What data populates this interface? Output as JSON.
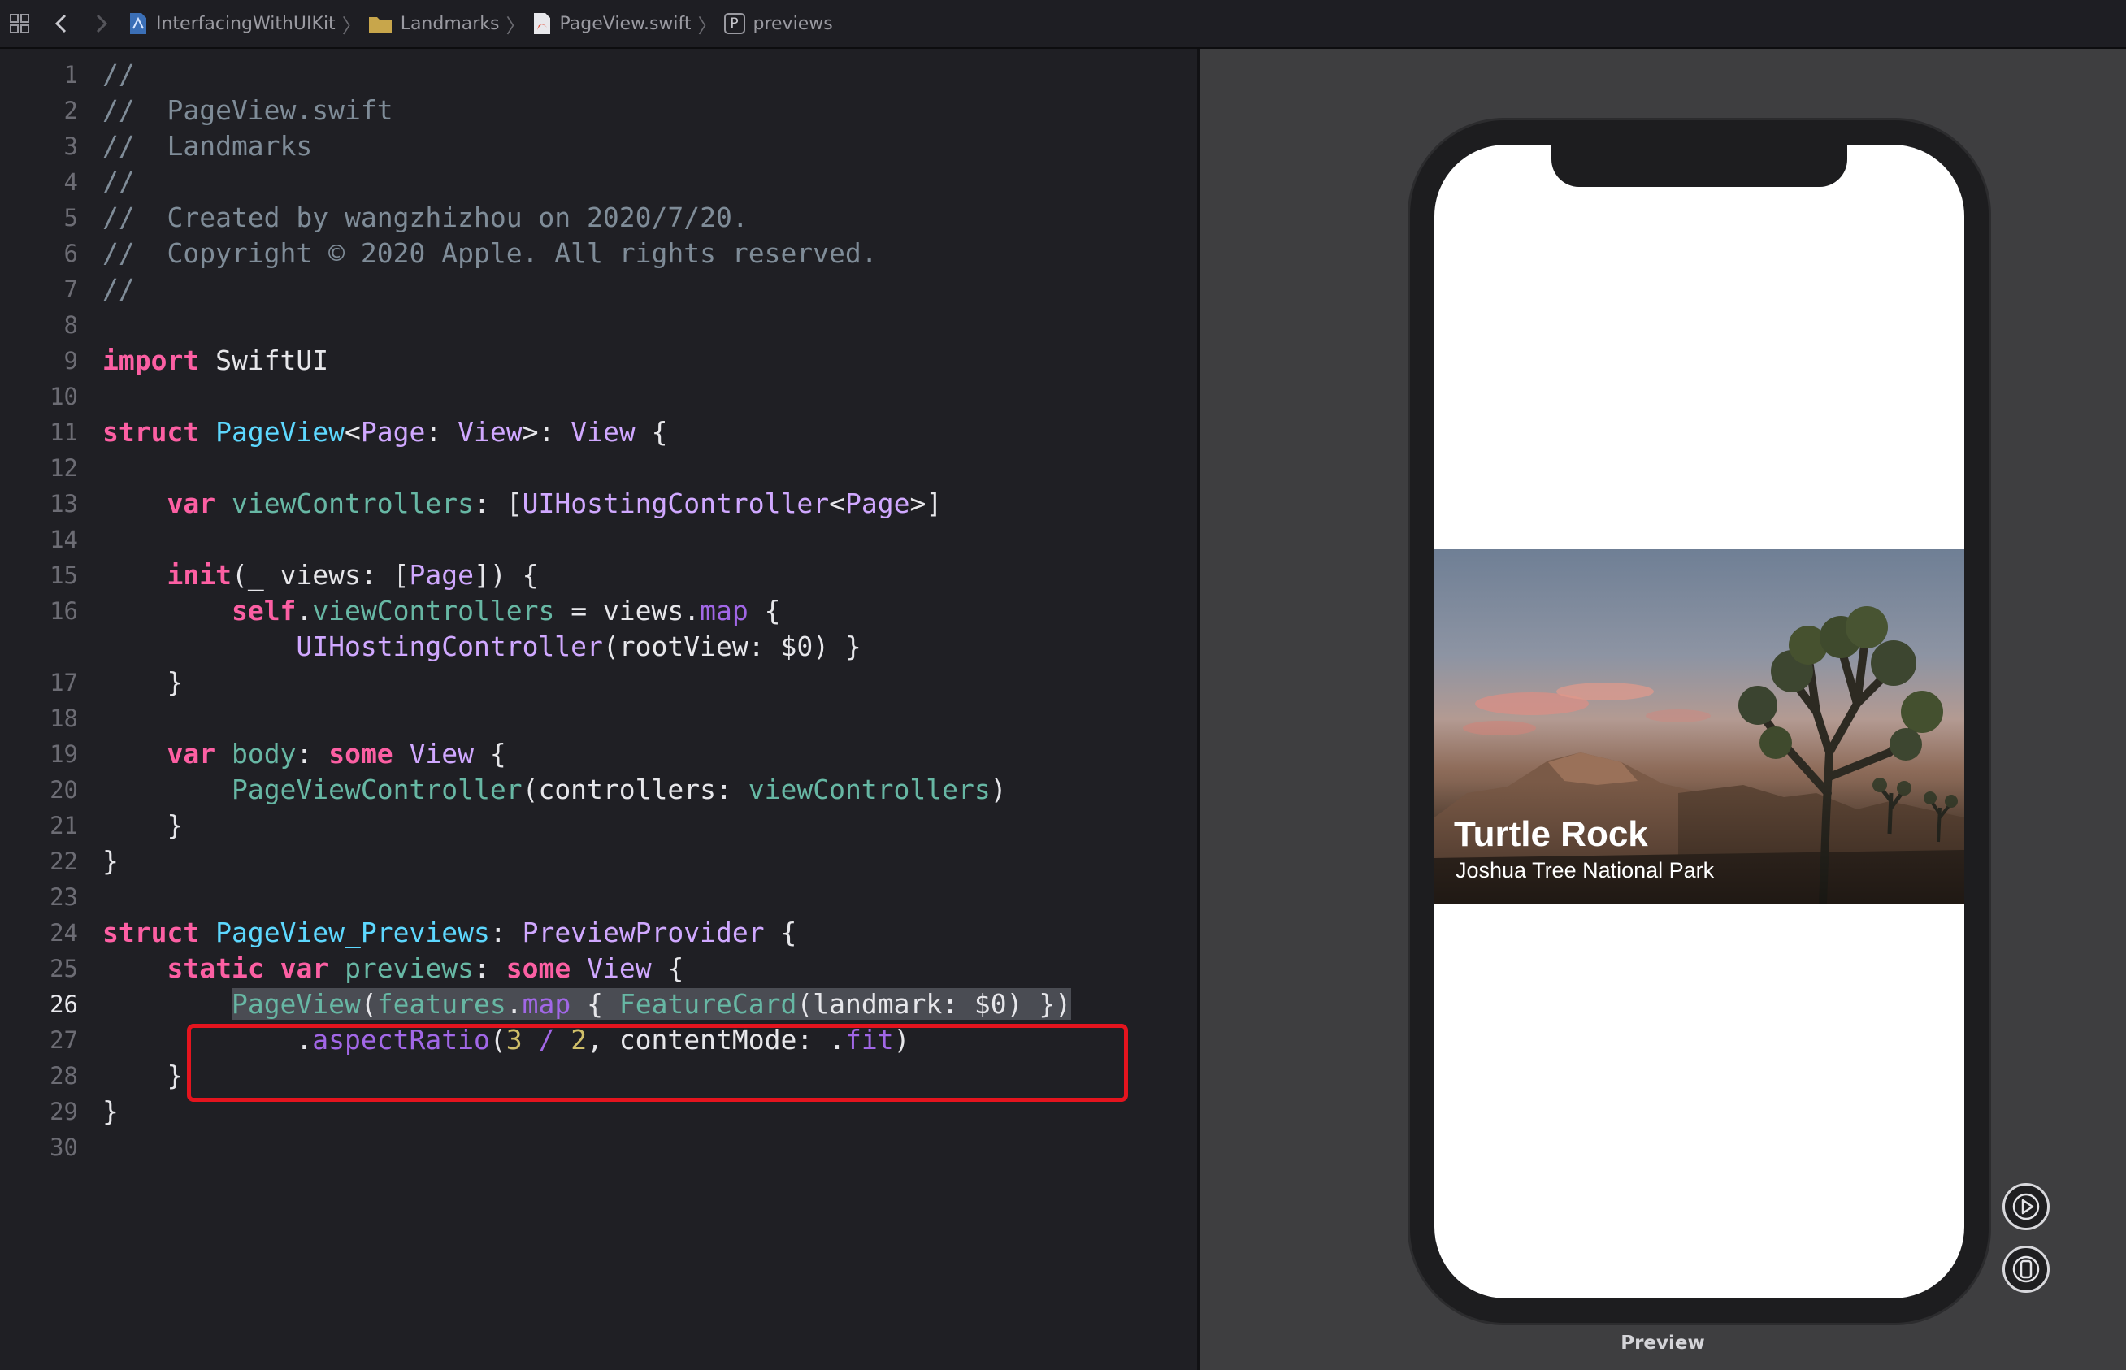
{
  "breadcrumb": {
    "items": [
      {
        "label": "InterfacingWithUIKit",
        "icon": "project-icon"
      },
      {
        "label": "Landmarks",
        "icon": "folder-icon"
      },
      {
        "label": "PageView.swift",
        "icon": "swift-file-icon"
      },
      {
        "label": "previews",
        "icon": "property-icon",
        "badge": "P"
      }
    ]
  },
  "editor": {
    "current_line": 26,
    "lines": [
      {
        "n": "1",
        "tokens": [
          [
            "cmt",
            "//"
          ]
        ]
      },
      {
        "n": "2",
        "tokens": [
          [
            "cmt",
            "//  PageView.swift"
          ]
        ]
      },
      {
        "n": "3",
        "tokens": [
          [
            "cmt",
            "//  Landmarks"
          ]
        ]
      },
      {
        "n": "4",
        "tokens": [
          [
            "cmt",
            "//"
          ]
        ]
      },
      {
        "n": "5",
        "tokens": [
          [
            "cmt",
            "//  Created by wangzhizhou on 2020/7/20."
          ]
        ]
      },
      {
        "n": "6",
        "tokens": [
          [
            "cmt",
            "//  Copyright © 2020 Apple. All rights reserved."
          ]
        ]
      },
      {
        "n": "7",
        "tokens": [
          [
            "cmt",
            "//"
          ]
        ]
      },
      {
        "n": "8",
        "tokens": []
      },
      {
        "n": "9",
        "tokens": [
          [
            "kw",
            "import"
          ],
          [
            "plain",
            " SwiftUI"
          ]
        ]
      },
      {
        "n": "10",
        "tokens": []
      },
      {
        "n": "11",
        "tokens": [
          [
            "kw",
            "struct"
          ],
          [
            "plain",
            " "
          ],
          [
            "dtype",
            "PageView"
          ],
          [
            "plain",
            "<"
          ],
          [
            "otype",
            "Page"
          ],
          [
            "plain",
            ": "
          ],
          [
            "otype",
            "View"
          ],
          [
            "plain",
            ">: "
          ],
          [
            "otype",
            "View"
          ],
          [
            "plain",
            " {"
          ]
        ]
      },
      {
        "n": "12",
        "tokens": []
      },
      {
        "n": "13",
        "tokens": [
          [
            "plain",
            "    "
          ],
          [
            "kw",
            "var"
          ],
          [
            "plain",
            " "
          ],
          [
            "prop",
            "viewControllers"
          ],
          [
            "plain",
            ": ["
          ],
          [
            "otype",
            "UIHostingController"
          ],
          [
            "plain",
            "<"
          ],
          [
            "otype",
            "Page"
          ],
          [
            "plain",
            ">]"
          ]
        ]
      },
      {
        "n": "14",
        "tokens": []
      },
      {
        "n": "15",
        "tokens": [
          [
            "plain",
            "    "
          ],
          [
            "kw",
            "init"
          ],
          [
            "plain",
            "(_ views: ["
          ],
          [
            "otype",
            "Page"
          ],
          [
            "plain",
            "]) {"
          ]
        ]
      },
      {
        "n": "16",
        "tokens": [
          [
            "plain",
            "        "
          ],
          [
            "kw",
            "self"
          ],
          [
            "plain",
            "."
          ],
          [
            "prop",
            "viewControllers"
          ],
          [
            "plain",
            " = views."
          ],
          [
            "omem",
            "map"
          ],
          [
            "plain",
            " {"
          ]
        ]
      },
      {
        "n": "",
        "tokens": [
          [
            "plain",
            "            "
          ],
          [
            "otype",
            "UIHostingController"
          ],
          [
            "plain",
            "(rootView: $0) }"
          ]
        ]
      },
      {
        "n": "17",
        "tokens": [
          [
            "plain",
            "    }"
          ]
        ]
      },
      {
        "n": "18",
        "tokens": []
      },
      {
        "n": "19",
        "tokens": [
          [
            "plain",
            "    "
          ],
          [
            "kw",
            "var"
          ],
          [
            "plain",
            " "
          ],
          [
            "prop",
            "body"
          ],
          [
            "plain",
            ": "
          ],
          [
            "kw",
            "some"
          ],
          [
            "plain",
            " "
          ],
          [
            "otype",
            "View"
          ],
          [
            "plain",
            " {"
          ]
        ]
      },
      {
        "n": "20",
        "tokens": [
          [
            "plain",
            "        "
          ],
          [
            "pfn",
            "PageViewController"
          ],
          [
            "plain",
            "(controllers: "
          ],
          [
            "prop",
            "viewControllers"
          ],
          [
            "plain",
            ")"
          ]
        ]
      },
      {
        "n": "21",
        "tokens": [
          [
            "plain",
            "    }"
          ]
        ]
      },
      {
        "n": "22",
        "tokens": [
          [
            "plain",
            "}"
          ]
        ]
      },
      {
        "n": "23",
        "tokens": []
      },
      {
        "n": "24",
        "tokens": [
          [
            "kw",
            "struct"
          ],
          [
            "plain",
            " "
          ],
          [
            "dtype",
            "PageView_Previews"
          ],
          [
            "plain",
            ": "
          ],
          [
            "otype",
            "PreviewProvider"
          ],
          [
            "plain",
            " {"
          ]
        ]
      },
      {
        "n": "25",
        "tokens": [
          [
            "plain",
            "    "
          ],
          [
            "kw",
            "static"
          ],
          [
            "plain",
            " "
          ],
          [
            "kw",
            "var"
          ],
          [
            "plain",
            " "
          ],
          [
            "prop",
            "previews"
          ],
          [
            "plain",
            ": "
          ],
          [
            "kw",
            "some"
          ],
          [
            "plain",
            " "
          ],
          [
            "otype",
            "View"
          ],
          [
            "plain",
            " {"
          ]
        ]
      },
      {
        "n": "26",
        "tokens": [
          [
            "plain",
            "        "
          ],
          [
            "pfn",
            "PageView",
            "sel"
          ],
          [
            "plain",
            "(",
            "sel"
          ],
          [
            "prop",
            "features",
            "sel"
          ],
          [
            "plain",
            ".",
            "sel"
          ],
          [
            "omem",
            "map",
            "sel"
          ],
          [
            "plain",
            " { ",
            "sel"
          ],
          [
            "pfn",
            "FeatureCard",
            "sel"
          ],
          [
            "plain",
            "(landmark: $0) })",
            "sel"
          ]
        ]
      },
      {
        "n": "27",
        "tokens": [
          [
            "plain",
            "            ."
          ],
          [
            "ofn",
            "aspectRatio"
          ],
          [
            "plain",
            "("
          ],
          [
            "num",
            "3"
          ],
          [
            "plain",
            " "
          ],
          [
            "ofn",
            "/"
          ],
          [
            "plain",
            " "
          ],
          [
            "num",
            "2"
          ],
          [
            "plain",
            ", contentMode: ."
          ],
          [
            "omem",
            "fit"
          ],
          [
            "plain",
            ")"
          ]
        ]
      },
      {
        "n": "28",
        "tokens": [
          [
            "plain",
            "    }"
          ]
        ]
      },
      {
        "n": "29",
        "tokens": [
          [
            "plain",
            "}"
          ]
        ]
      },
      {
        "n": "30",
        "tokens": []
      }
    ]
  },
  "preview": {
    "card_title": "Turtle Rock",
    "card_subtitle": "Joshua Tree National Park",
    "label": "Preview",
    "live_button_icon": "play-icon",
    "device_button_icon": "device-icon"
  }
}
